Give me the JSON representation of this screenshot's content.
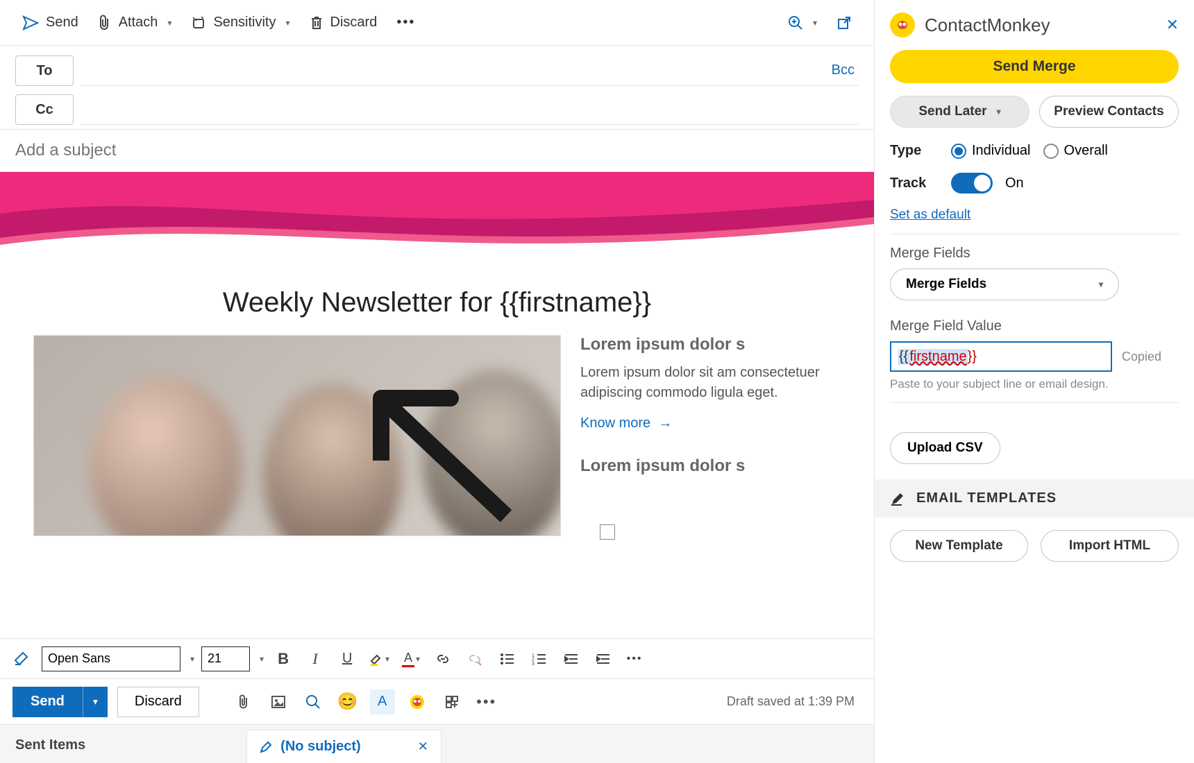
{
  "toolbar": {
    "send": "Send",
    "attach": "Attach",
    "sensitivity": "Sensitivity",
    "discard": "Discard"
  },
  "compose": {
    "to_label": "To",
    "cc_label": "Cc",
    "bcc_label": "Bcc",
    "subject_placeholder": "Add a subject"
  },
  "newsletter": {
    "headline": "Weekly Newsletter for {{firstname}}",
    "block1": {
      "title": "Lorem ipsum dolor s",
      "body": "Lorem ipsum dolor sit am consectetuer adipiscing commodo ligula eget.",
      "link": "Know more"
    },
    "block2": {
      "title": "Lorem ipsum dolor s"
    }
  },
  "format": {
    "font_name": "Open Sans",
    "font_size": "21"
  },
  "actions": {
    "send": "Send",
    "discard": "Discard",
    "draft_status": "Draft saved at 1:39 PM"
  },
  "footer": {
    "folder": "Sent Items",
    "tab_title": "(No subject)"
  },
  "panel": {
    "title": "ContactMonkey",
    "send_merge": "Send Merge",
    "send_later": "Send Later",
    "preview_contacts": "Preview Contacts",
    "type_label": "Type",
    "type_individual": "Individual",
    "type_overall": "Overall",
    "track_label": "Track",
    "track_state": "On",
    "set_default": "Set as default",
    "merge_fields_label": "Merge Fields",
    "merge_fields_select": "Merge Fields",
    "merge_value_label": "Merge Field Value",
    "merge_value_open": "{{",
    "merge_value_word": "firstname",
    "merge_value_close": "}}",
    "copied": "Copied",
    "merge_hint": "Paste to your subject line or email design.",
    "upload_csv": "Upload CSV",
    "templates_header": "EMAIL TEMPLATES",
    "new_template": "New Template",
    "import_html": "Import HTML"
  },
  "colors": {
    "accent": "#0f6cbd",
    "brand_yellow": "#ffd500",
    "wave_a": "#c31a6b",
    "wave_b": "#ed2a7b",
    "wave_c": "#f05a8c"
  }
}
